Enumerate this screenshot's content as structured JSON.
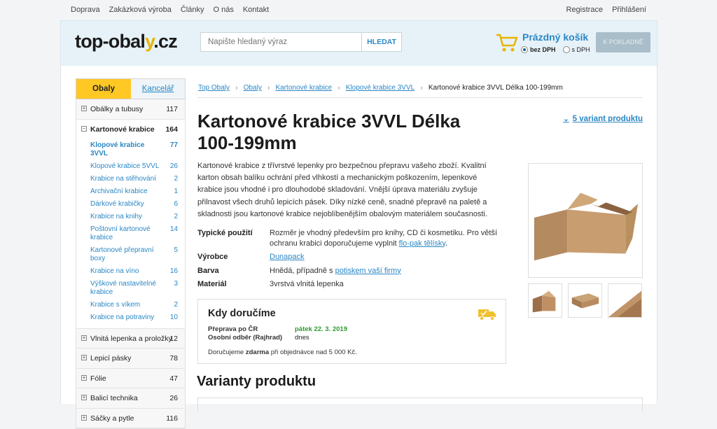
{
  "topnav": {
    "left": [
      "Doprava",
      "Zakázková výroba",
      "Články",
      "O nás",
      "Kontakt"
    ],
    "right": [
      "Registrace",
      "Přihlášení"
    ]
  },
  "header": {
    "logo_main": "top-obal",
    "logo_y": "y",
    "logo_tld": ".cz",
    "search_placeholder": "Napište hledaný výraz",
    "search_button": "HLEDAT",
    "cart_title": "Prázdný košík",
    "vat_without": "bez DPH",
    "vat_with": "s DPH",
    "checkout": "K POKLADNĚ"
  },
  "sidebar": {
    "tab_active": "Obaly",
    "tab_other": "Kancelář",
    "categories_before": [
      {
        "name": "Obálky a tubusy",
        "count": "117"
      }
    ],
    "open_category": {
      "name": "Kartonové krabice",
      "count": "164"
    },
    "subcategories": [
      {
        "name": "Klopové krabice 3VVL",
        "count": "77"
      },
      {
        "name": "Klopové krabice 5VVL",
        "count": "26"
      },
      {
        "name": "Krabice na stěhování",
        "count": "2"
      },
      {
        "name": "Archivační krabice",
        "count": "1"
      },
      {
        "name": "Dárkové krabičky",
        "count": "6"
      },
      {
        "name": "Krabice na knihy",
        "count": "2"
      },
      {
        "name": "Poštovní kartonové krabice",
        "count": "14"
      },
      {
        "name": "Kartonové přepravní boxy",
        "count": "5"
      },
      {
        "name": "Krabice na víno",
        "count": "16"
      },
      {
        "name": "Výškové nastavitelné krabice",
        "count": "3"
      },
      {
        "name": "Krabice s víkem",
        "count": "2"
      },
      {
        "name": "Krabice na potraviny",
        "count": "10"
      }
    ],
    "categories_after": [
      {
        "name": "Vlnitá lepenka a proložky",
        "count": "12"
      },
      {
        "name": "Lepicí pásky",
        "count": "78"
      },
      {
        "name": "Fólie",
        "count": "47"
      },
      {
        "name": "Balicí technika",
        "count": "26"
      },
      {
        "name": "Sáčky a pytle",
        "count": "116"
      }
    ]
  },
  "breadcrumb": [
    "Top Obaly",
    "Obaly",
    "Kartonové krabice",
    "Klopové krabice 3VVL",
    "Kartonové krabice 3VVL Délka 100-199mm"
  ],
  "product": {
    "title": "Kartonové krabice 3VVL Délka 100-199mm",
    "variants_link": "5 variant produktu",
    "description": "Kartonové krabice z třívrstvé lepenky pro bezpečnou přepravu vašeho zboží. Kvalitní karton obsah balíku ochrání před vlhkostí a mechanickým poškozením, lepenkové krabice jsou vhodné i pro dlouhodobé skladování. Vnější úprava materiálu zvyšuje přilnavost všech druhů lepicích pásek. Díky nízké ceně, snadné přepravě na paletě a skladnosti jsou kartonové krabice nejoblíbenějším obalovým materiálem současnosti.",
    "specs": {
      "usage_label": "Typické použití",
      "usage_text": "Rozměr je vhodný především pro knihy, CD či kosmetiku. Pro větší ochranu krabici doporučujeme vyplnit ",
      "usage_link": "flo-pak tělísky",
      "usage_end": ".",
      "maker_label": "Výrobce",
      "maker": "Dunapack",
      "color_label": "Barva",
      "color_text": "Hnědá, případně s ",
      "color_link": "potiskem vaší firmy",
      "material_label": "Materiál",
      "material": "3vrstvá vlnitá lepenka"
    }
  },
  "delivery": {
    "title": "Kdy doručíme",
    "row1_label": "Přeprava po ČR",
    "row1_value": "pátek 22. 3. 2019",
    "row2_label": "Osobní odběr (Rajhrad)",
    "row2_value": "dnes",
    "note_pre": "Doručujeme ",
    "note_bold": "zdarma",
    "note_post": " při objednávce nad 5 000 Kč."
  },
  "variants_heading": "Varianty produktu",
  "colors": {
    "accent": "#2a87c4",
    "yellow": "#ffc825",
    "green": "#2f9a2f"
  }
}
